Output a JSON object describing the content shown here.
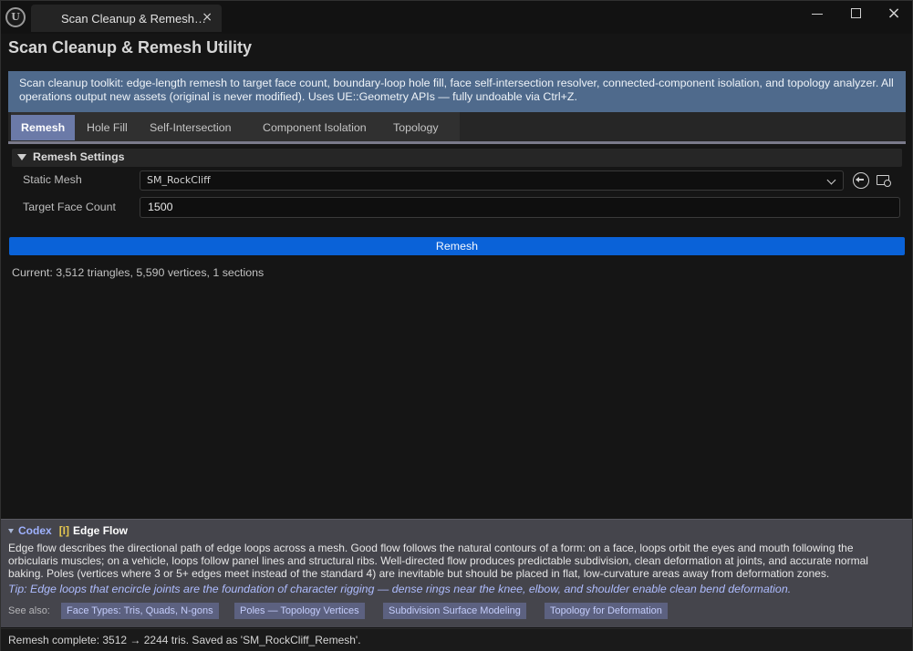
{
  "window": {
    "tab_title": "Scan Cleanup & Remesh…",
    "close_glyph": "×"
  },
  "page": {
    "title": "Scan Cleanup & Remesh Utility",
    "description": "Scan cleanup toolkit: edge-length remesh to target face count, boundary-loop hole fill, face self-intersection resolver, connected-component isolation, and topology analyzer. All operations output new assets (original is never modified). Uses UE::Geometry APIs — fully undoable via Ctrl+Z."
  },
  "mode_tabs": [
    {
      "label": "Remesh",
      "active": true
    },
    {
      "label": "Hole Fill",
      "active": false
    },
    {
      "label": "Self-Intersection",
      "active": false
    },
    {
      "label": "Component Isolation",
      "active": false
    },
    {
      "label": "Topology",
      "active": false
    }
  ],
  "remesh_settings": {
    "section_label": "Remesh Settings",
    "static_mesh_label": "Static Mesh",
    "static_mesh_value": "SM_RockCliff",
    "target_face_count_label": "Target Face Count",
    "target_face_count_value": "1500",
    "action_label": "Remesh",
    "current_stats": "Current: 3,512 triangles, 5,590 vertices, 1 sections"
  },
  "codex": {
    "brand": "Codex",
    "badge": "[I]",
    "topic": "Edge Flow",
    "body": "Edge flow describes the directional path of edge loops across a mesh. Good flow follows the natural contours of a form: on a face, loops orbit the eyes and mouth following the orbicularis muscles; on a vehicle, loops follow panel lines and structural ribs. Well-directed flow produces predictable subdivision, clean deformation at joints, and accurate normal baking. Poles (vertices where 3 or 5+ edges meet instead of the standard 4) are inevitable but should be placed in flat, low-curvature areas away from deformation zones.",
    "tip": "Tip: Edge loops that encircle joints are the foundation of character rigging — dense rings near the knee, elbow, and shoulder enable clean bend deformation.",
    "see_also_label": "See also:",
    "see_also": [
      "Face Types: Tris, Quads, N-gons",
      "Poles — Topology Vertices",
      "Subdivision Surface Modeling",
      "Topology for Deformation"
    ]
  },
  "status_bar": {
    "message": "Remesh complete: 3512 → 2244 tris. Saved as 'SM_RockCliff_Remesh'."
  }
}
